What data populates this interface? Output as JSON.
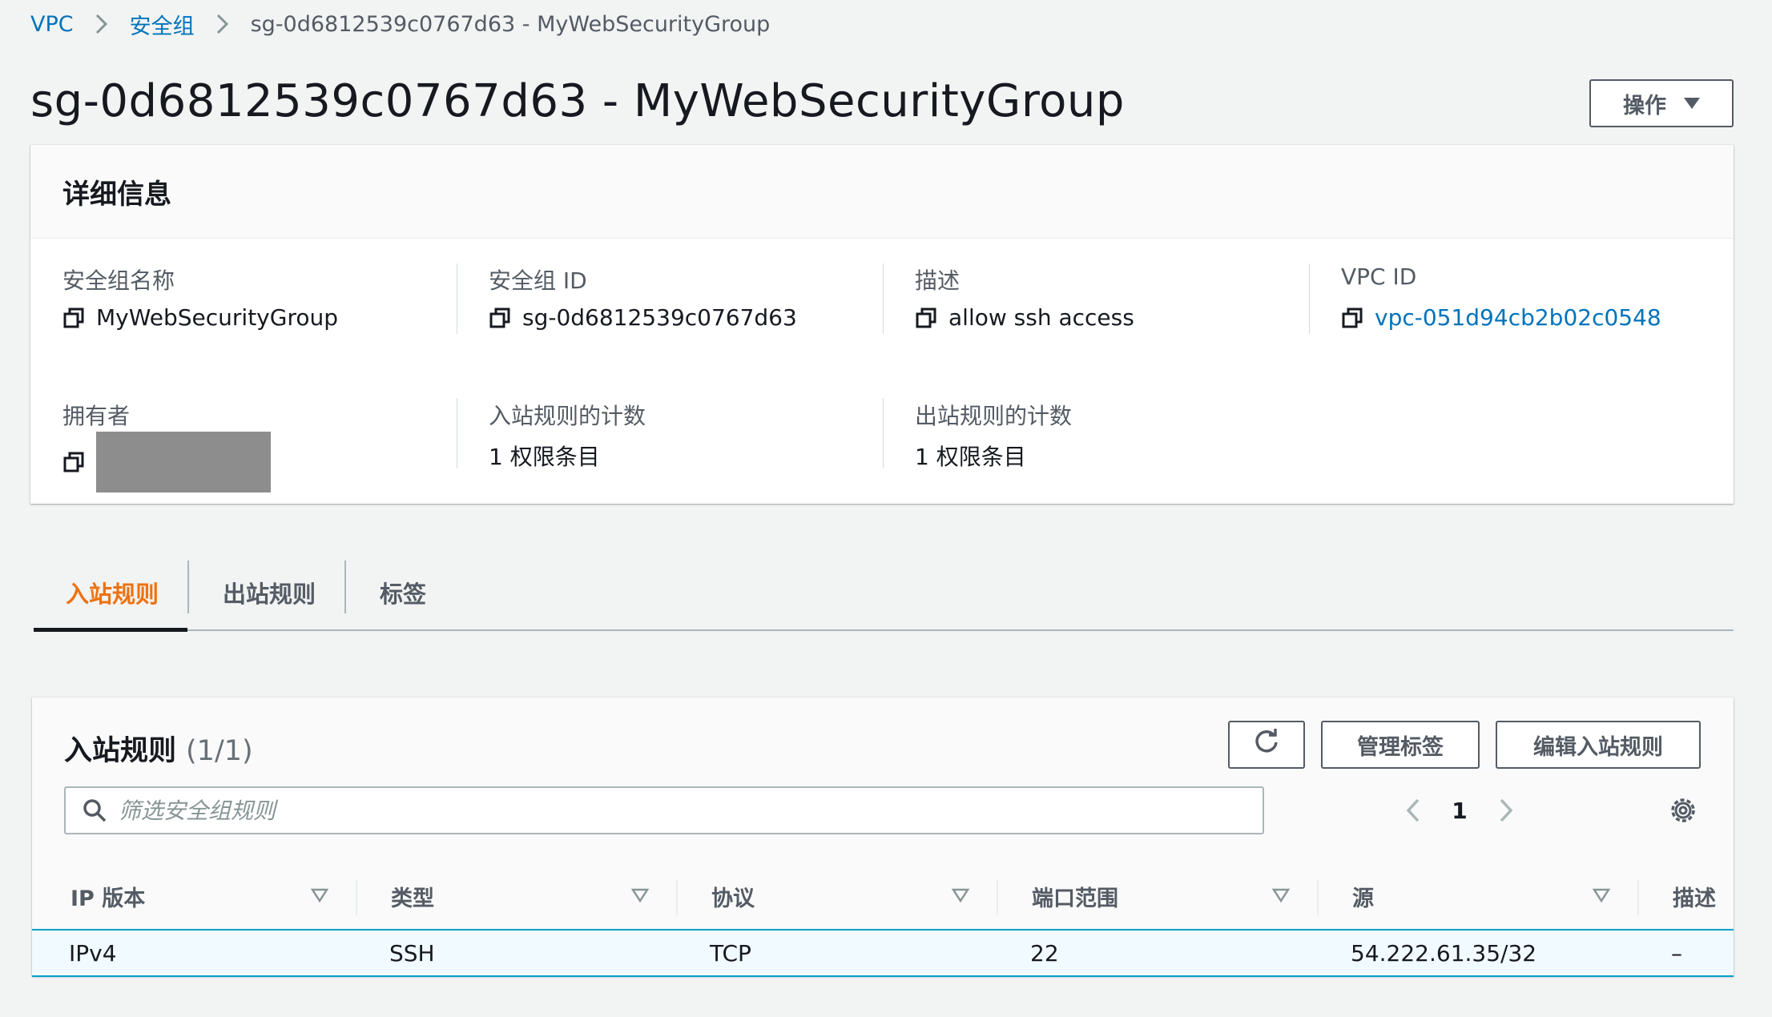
{
  "breadcrumb": {
    "items": [
      {
        "label": "VPC"
      },
      {
        "label": "安全组"
      },
      {
        "label": "sg-0d6812539c0767d63 - MyWebSecurityGroup"
      }
    ]
  },
  "page": {
    "title": "sg-0d6812539c0767d63 - MyWebSecurityGroup",
    "actions_label": "操作"
  },
  "details": {
    "header": "详细信息",
    "fields": [
      {
        "label": "安全组名称",
        "value": "MyWebSecurityGroup"
      },
      {
        "label": "安全组 ID",
        "value": "sg-0d6812539c0767d63"
      },
      {
        "label": "描述",
        "value": "allow ssh access"
      },
      {
        "label": "VPC ID",
        "value": "vpc-051d94cb2b02c0548"
      },
      {
        "label": "拥有者",
        "value": ""
      },
      {
        "label": "入站规则的计数",
        "value": "1 权限条目"
      },
      {
        "label": "出站规则的计数",
        "value": "1 权限条目"
      }
    ]
  },
  "tabs": [
    {
      "label": "入站规则",
      "active": true
    },
    {
      "label": "出站规则",
      "active": false
    },
    {
      "label": "标签",
      "active": false
    }
  ],
  "rules": {
    "title": "入站规则",
    "count": "(1/1)",
    "manage_tags_label": "管理标签",
    "edit_label": "编辑入站规则",
    "search_placeholder": "筛选安全组规则",
    "current_page": "1",
    "columns": [
      "IP 版本",
      "类型",
      "协议",
      "端口范围",
      "源",
      "描述"
    ],
    "rows": [
      {
        "ip_version": "IPv4",
        "type": "SSH",
        "protocol": "TCP",
        "port_range": "22",
        "source": "54.222.61.35/32",
        "description": "–"
      }
    ]
  },
  "colors": {
    "link": "#0073bb",
    "active_tab": "#ec7211",
    "selected_row_border": "#00a1c9",
    "selected_row_bg": "#f1faff"
  }
}
